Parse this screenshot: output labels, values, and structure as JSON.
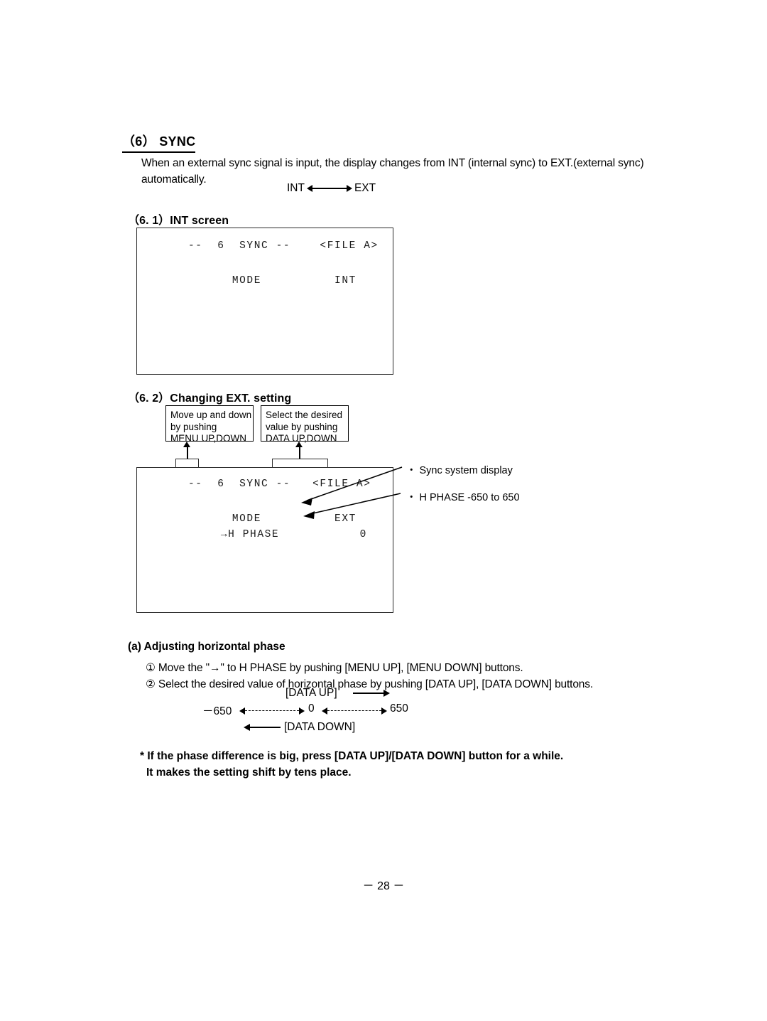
{
  "section": {
    "number": "（6）",
    "title": "SYNC",
    "intro_line_1": "When an external sync signal is input, the display changes from INT (internal sync) to EXT.(external sync)",
    "intro_line_2": "automatically.",
    "mode_left": "INT",
    "mode_right": "EXT"
  },
  "int_screen": {
    "heading": "（6. 1）INT screen",
    "osd": {
      "title_line": "--  6  SYNC --    <FILE A>",
      "row_label": "MODE",
      "row_value": "INT"
    }
  },
  "ext_setting": {
    "heading": "（6. 2）Changing EXT. setting",
    "callouts": [
      {
        "line_1": "Move up and down",
        "line_2": "by pushing",
        "line_3": "MENU UP,DOWN"
      },
      {
        "line_1": "Select the desired",
        "line_2": "value by pushing",
        "line_3": "DATA UP,DOWN"
      }
    ],
    "osd": {
      "title_line": "--  6  SYNC --   <FILE A>",
      "mode_label": "MODE",
      "mode_value": "EXT",
      "phase_label": "→H PHASE",
      "phase_value": "0"
    },
    "annotations": [
      {
        "bullet": "・",
        "text": "Sync system display"
      },
      {
        "bullet": "・",
        "text": "H PHASE   -650 to 650"
      }
    ]
  },
  "adjusting": {
    "heading": "(a) Adjusting horizontal phase",
    "step_1": "① Move the \"→\" to H PHASE by pushing [MENU UP], [MENU DOWN] buttons.",
    "step_2": "② Select the desired value of horizontal phase by pushing [DATA UP], [DATA DOWN] buttons.",
    "range": {
      "up_label": "[DATA UP]",
      "down_label": "[DATA DOWN]",
      "min": "－650",
      "center": "0",
      "max": "650"
    }
  },
  "note": {
    "line_1": "* If the phase difference is big, press [DATA UP]/[DATA DOWN] button for a while.",
    "line_2": "It makes the setting shift by tens place."
  },
  "footer": {
    "page": "－ 28 －"
  }
}
